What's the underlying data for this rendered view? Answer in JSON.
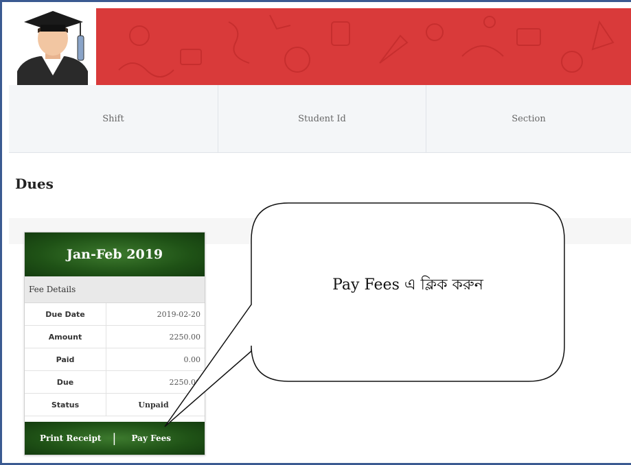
{
  "info_row": {
    "shift_label": "Shift",
    "student_id_label": "Student Id",
    "section_label": "Section"
  },
  "section_title": "Dues",
  "card": {
    "period": "Jan-Feb 2019",
    "fee_details_label": "Fee Details",
    "rows": [
      {
        "label": "Due Date",
        "value": "2019-02-20"
      },
      {
        "label": "Amount",
        "value": "2250.00"
      },
      {
        "label": "Paid",
        "value": "0.00"
      },
      {
        "label": "Due",
        "value": "2250.00"
      },
      {
        "label": "Status",
        "value": "Unpaid"
      }
    ],
    "print_receipt": "Print Receipt",
    "separator": "|",
    "pay_fees": "Pay Fees"
  },
  "callout": {
    "text": "Pay Fees এ ক্লিক করুন"
  },
  "colors": {
    "header_red": "#d93a3a",
    "card_green": "#1f5216",
    "frame_blue": "#3b5a91"
  },
  "icons": {
    "avatar": "graduate-avatar-icon"
  }
}
